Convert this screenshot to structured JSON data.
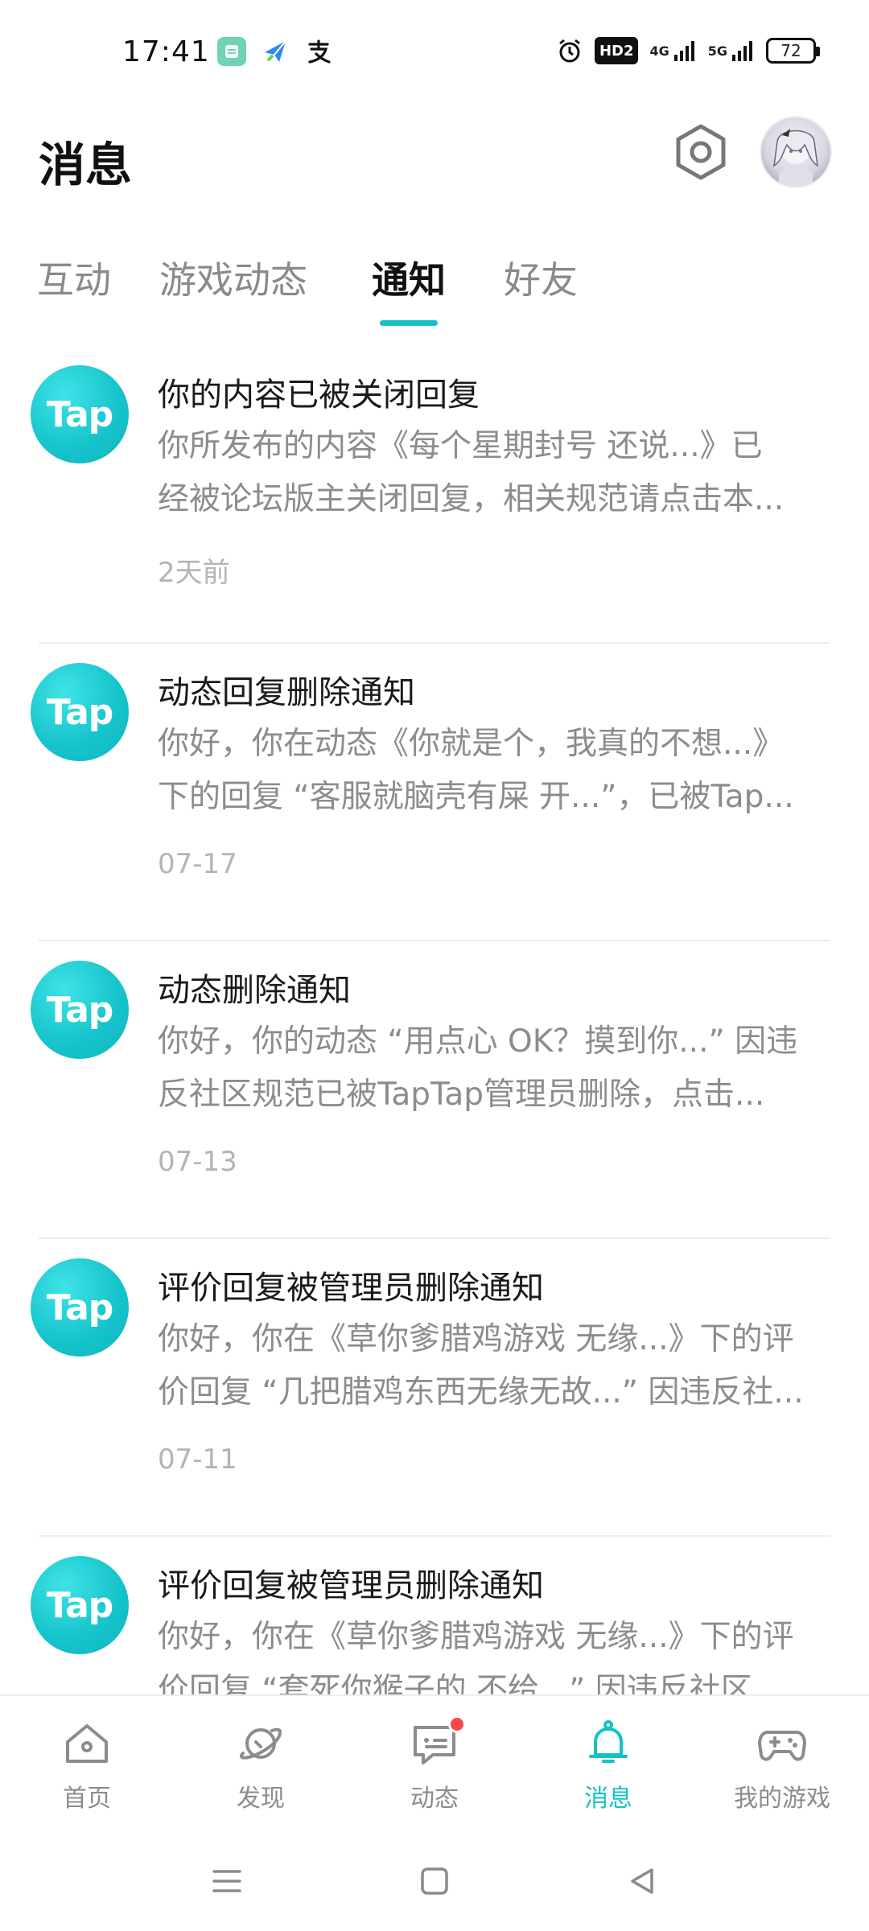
{
  "status_bar": {
    "time": "17:41",
    "apps": [
      "app-icon",
      "send-icon",
      "alipay-icon"
    ],
    "network_1": "4G",
    "network_2": "5G",
    "hd_label": "HD2",
    "battery": "72"
  },
  "header": {
    "title": "消息"
  },
  "tabs": [
    {
      "label": "互动",
      "active": false
    },
    {
      "label": "游戏动态",
      "active": false
    },
    {
      "label": "通知",
      "active": true
    },
    {
      "label": "好友",
      "active": false
    }
  ],
  "notifications": [
    {
      "logo": "Tap",
      "title": "你的内容已被关闭回复",
      "line1": "你所发布的内容《每个星期封号  还说...》已",
      "line2": "经被论坛版主关闭回复，相关规范请点击本...",
      "date": "2天前"
    },
    {
      "logo": "Tap",
      "title": "动态回复删除通知",
      "line1": "你好，你在动态《你就是个，我真的不想...》",
      "line2": "下的回复 “客服就脑壳有屎  开...”，已被Tap...",
      "date": "07-17"
    },
    {
      "logo": "Tap",
      "title": "动态删除通知",
      "line1": "你好，你的动态 “用点心 OK？摸到你...” 因违",
      "line2": "反社区规范已被TapTap管理员删除，点击...",
      "date": "07-13"
    },
    {
      "logo": "Tap",
      "title": "评价回复被管理员删除通知",
      "line1": "你好，你在《草你爹腊鸡游戏 无缘...》下的评",
      "line2": "价回复 “几把腊鸡东西无缘无故...” 因违反社...",
      "date": "07-11"
    },
    {
      "logo": "Tap",
      "title": "评价回复被管理员删除通知",
      "line1": "你好，你在《草你爹腊鸡游戏 无缘...》下的评",
      "line2": "价回复 “套死你猴子的 不给...” 因违反社区...",
      "date": ""
    }
  ],
  "bottom_nav": [
    {
      "label": "首页",
      "icon": "home-icon"
    },
    {
      "label": "发现",
      "icon": "planet-icon"
    },
    {
      "label": "动态",
      "icon": "chat-icon",
      "badge": true
    },
    {
      "label": "消息",
      "icon": "bell-icon",
      "active": true
    },
    {
      "label": "我的游戏",
      "icon": "gamepad-icon"
    }
  ],
  "colors": {
    "accent": "#14c2c6",
    "badge": "#f5474c",
    "text_secondary": "#8c8c8c"
  }
}
